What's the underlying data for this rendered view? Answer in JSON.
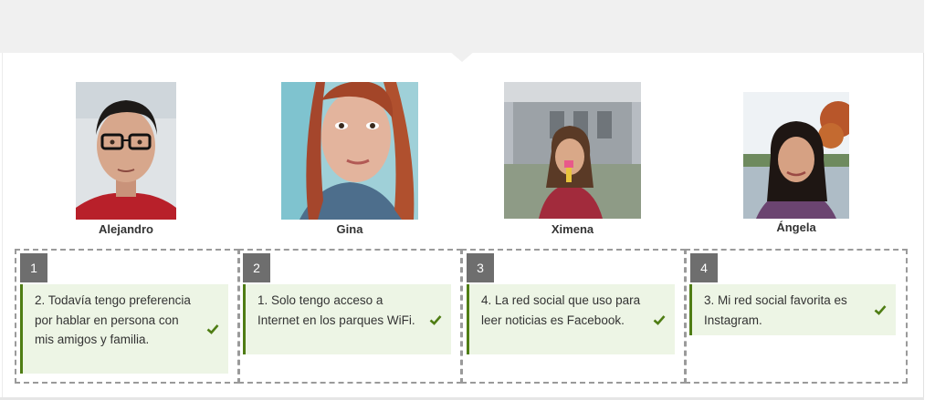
{
  "people": [
    {
      "name": "Alejandro"
    },
    {
      "name": "Gina"
    },
    {
      "name": "Ximena"
    },
    {
      "name": "Ángela"
    }
  ],
  "zones": [
    {
      "number": "1",
      "answer": "2. Todavía tengo preferencia por hablar en persona con mis amigos y familia."
    },
    {
      "number": "2",
      "answer": "1. Solo tengo acceso a Internet en los parques WiFi."
    },
    {
      "number": "3",
      "answer": "4. La red social que uso para leer noticias es Facebook."
    },
    {
      "number": "4",
      "answer": "3. Mi red social favorita es Instagram."
    }
  ],
  "colors": {
    "card_bg": "#edf5e5",
    "card_accent": "#4f7d14",
    "check": "#4f7d14",
    "badge": "#6e6e6e"
  },
  "icons": {
    "correct": "check-icon"
  }
}
